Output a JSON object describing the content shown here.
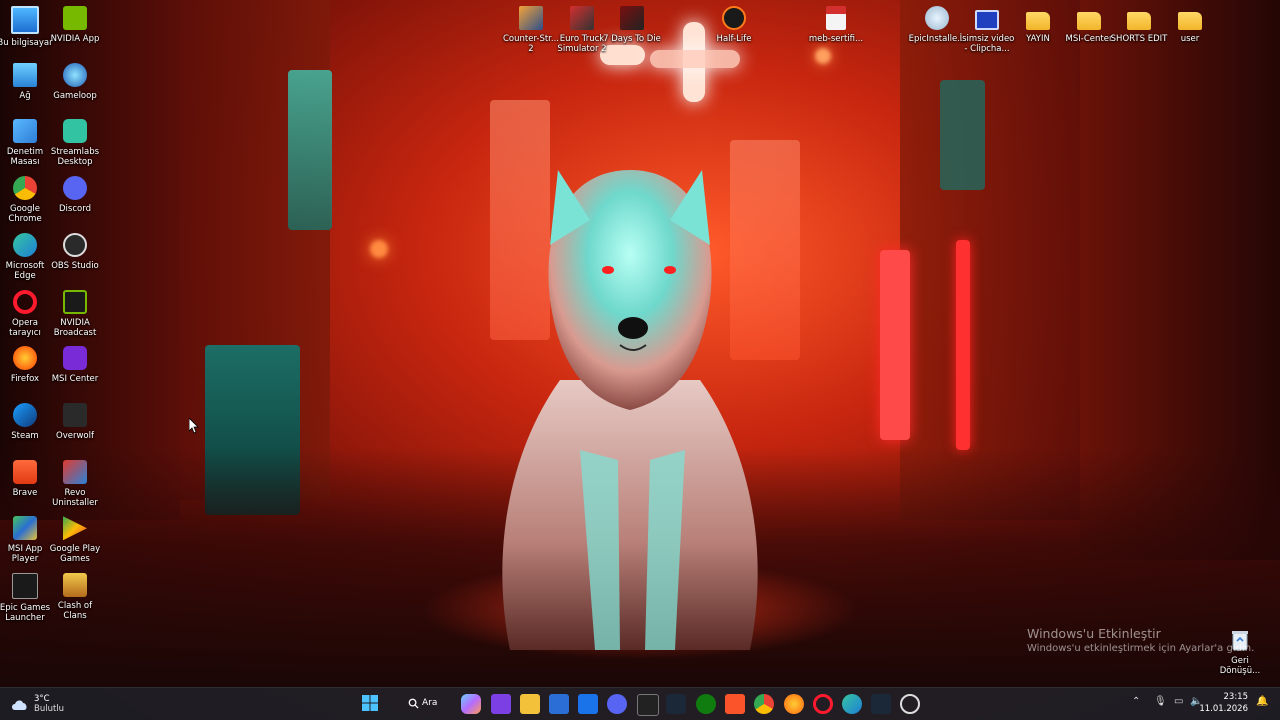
{
  "desktop": {
    "left_column_1": [
      {
        "label": "Bu bilgisayar",
        "icon": "computer-icon"
      },
      {
        "label": "Ağ",
        "icon": "network-icon"
      },
      {
        "label": "Denetim Masası",
        "icon": "control-panel-icon"
      },
      {
        "label": "Google Chrome",
        "icon": "chrome-icon"
      },
      {
        "label": "Microsoft Edge",
        "icon": "edge-icon"
      },
      {
        "label": "Opera tarayıcı",
        "icon": "opera-icon"
      },
      {
        "label": "Firefox",
        "icon": "firefox-icon"
      },
      {
        "label": "Steam",
        "icon": "steam-icon"
      },
      {
        "label": "Brave",
        "icon": "brave-icon"
      },
      {
        "label": "MSI App Player",
        "icon": "msi-app-player-icon"
      },
      {
        "label": "Epic Games Launcher",
        "icon": "epic-games-icon"
      }
    ],
    "left_column_2": [
      {
        "label": "NVIDIA App",
        "icon": "nvidia-icon"
      },
      {
        "label": "Gameloop",
        "icon": "gameloop-icon"
      },
      {
        "label": "Streamlabs Desktop",
        "icon": "streamlabs-icon"
      },
      {
        "label": "Discord",
        "icon": "discord-icon"
      },
      {
        "label": "OBS Studio",
        "icon": "obs-icon"
      },
      {
        "label": "NVIDIA Broadcast",
        "icon": "nvidia-broadcast-icon"
      },
      {
        "label": "MSI Center",
        "icon": "msi-center-icon"
      },
      {
        "label": "Overwolf",
        "icon": "overwolf-icon"
      },
      {
        "label": "Revo Uninstaller",
        "icon": "revo-icon"
      },
      {
        "label": "Google Play Games",
        "icon": "google-play-games-icon"
      },
      {
        "label": "Clash of Clans",
        "icon": "clash-of-clans-icon"
      }
    ],
    "top_row": [
      {
        "label": "Counter-Str... 2",
        "icon": "counter-strike-icon"
      },
      {
        "label": "Euro Truck Simulator 2",
        "icon": "euro-truck-icon"
      },
      {
        "label": "7 Days To Die",
        "icon": "seven-days-icon"
      },
      {
        "label": "Half-Life",
        "icon": "half-life-icon"
      },
      {
        "label": "meb-sertifi...",
        "icon": "pdf-icon"
      },
      {
        "label": "EpicInstalle...",
        "icon": "installer-icon"
      },
      {
        "label": "İsimsiz video - Clipcha...",
        "icon": "video-icon"
      },
      {
        "label": "YAYIN",
        "icon": "folder-icon"
      },
      {
        "label": "MSI-Center",
        "icon": "folder-icon"
      },
      {
        "label": "SHORTS EDIT",
        "icon": "folder-icon"
      },
      {
        "label": "user",
        "icon": "folder-icon"
      }
    ],
    "recycle_bin": {
      "label": "Geri Dönüşü...",
      "icon": "recycle-bin-icon"
    }
  },
  "watermark": {
    "title": "Windows'u Etkinleştir",
    "subtitle": "Windows'u etkinleştirmek için Ayarlar'a gidin."
  },
  "taskbar": {
    "weather": {
      "temp": "3°C",
      "desc": "Bulutlu"
    },
    "search_label": "Ara",
    "apps": [
      "start-icon",
      "search-icon",
      "copilot-icon",
      "clipchamp-icon",
      "file-explorer-icon",
      "store-icon",
      "outlook-icon",
      "discord-icon",
      "epic-games-icon",
      "steam-icon",
      "xbox-icon",
      "brave-icon",
      "chrome-icon",
      "firefox-icon",
      "opera-icon",
      "edge-icon",
      "steam-active-icon",
      "obs-icon"
    ],
    "clock": {
      "time": "23:15",
      "date": "11.01.2026"
    }
  },
  "colors": {
    "taskbar_bg": "#1c1e26",
    "accent": "#ff3a1a",
    "wolf_glow": "#3ee0d0"
  }
}
